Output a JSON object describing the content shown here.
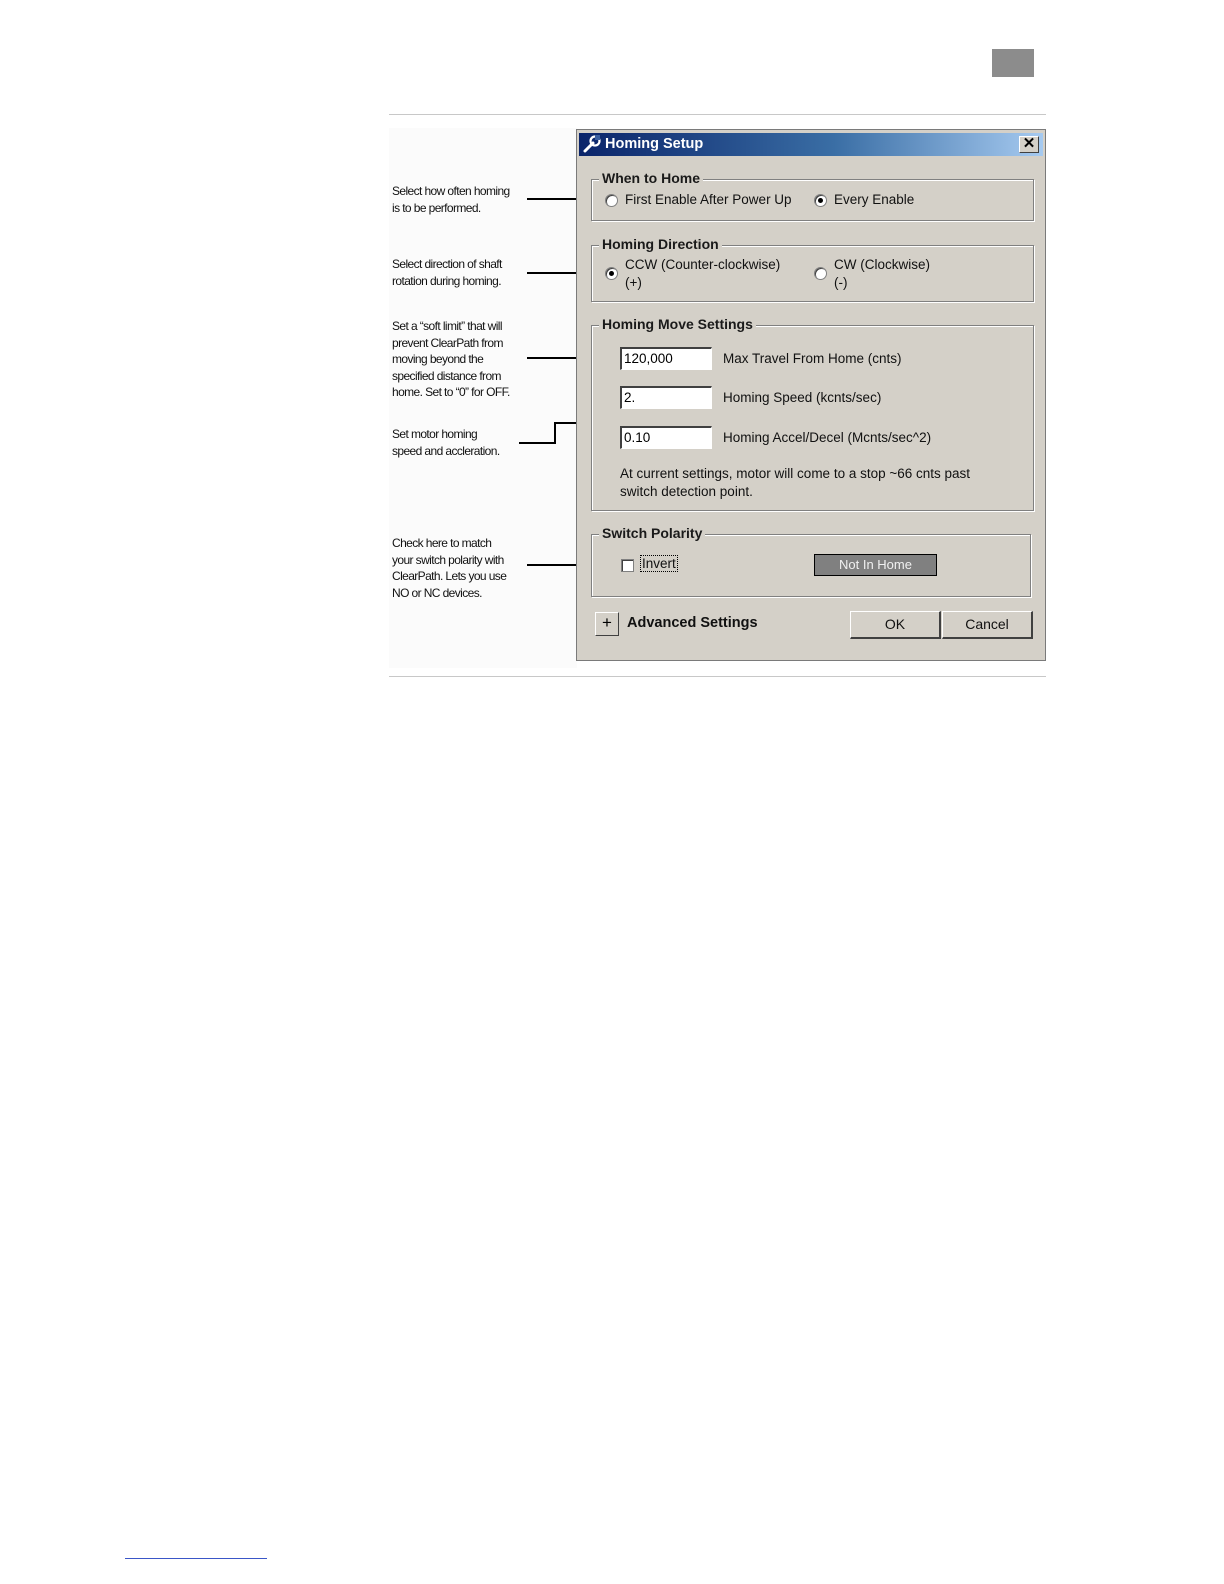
{
  "dialog": {
    "title": "Homing Setup",
    "close_glyph": "✕"
  },
  "when_to_home": {
    "legend": "When to Home",
    "option_first_enable": "First Enable After Power Up",
    "option_every_enable": "Every Enable",
    "selected": "Every Enable"
  },
  "homing_direction": {
    "legend": "Homing Direction",
    "ccw_line1": "CCW (Counter-clockwise)",
    "ccw_line2": "(+)",
    "cw_line1": "CW (Clockwise)",
    "cw_line2": "(-)",
    "selected": "CCW (Counter-clockwise)"
  },
  "homing_move": {
    "legend": "Homing Move Settings",
    "max_travel_value": "120,000",
    "max_travel_label": "Max Travel From Home (cnts)",
    "speed_value": "2.",
    "speed_label": "Homing Speed (kcnts/sec)",
    "accel_value": "0.10",
    "accel_label": "Homing Accel/Decel (Mcnts/sec^2)",
    "note_line1": "At current settings, motor will come to a stop ~66 cnts past",
    "note_line2": "switch detection point."
  },
  "switch_polarity": {
    "legend": "Switch Polarity",
    "invert_label": "Invert",
    "invert_checked": false,
    "status": "Not In Home"
  },
  "footer": {
    "expand_glyph": "+",
    "advanced_label": "Advanced Settings",
    "ok_label": "OK",
    "cancel_label": "Cancel"
  },
  "callouts": {
    "when_to_home": [
      "Select how often homing",
      "is to be performed."
    ],
    "direction": [
      "Select direction of shaft",
      "rotation during homing."
    ],
    "soft_limit": [
      "Set a “soft limit” that will",
      "prevent ClearPath from",
      "moving beyond the",
      "specified distance from",
      "home. Set to “0” for OFF."
    ],
    "speed_accel": [
      "Set motor homing",
      "speed and accleration."
    ],
    "polarity": [
      "Check here to match",
      "your switch polarity with",
      "ClearPath. Lets you use",
      "NO or NC devices."
    ]
  },
  "colors": {
    "dialog_face": "#d4d0c8",
    "title_gradient_start": "#0a246a",
    "title_gradient_end": "#a6caf0",
    "status_box": "#808080",
    "page_tab": "#8c8c8c",
    "footer_link_line": "#3a56c8"
  }
}
